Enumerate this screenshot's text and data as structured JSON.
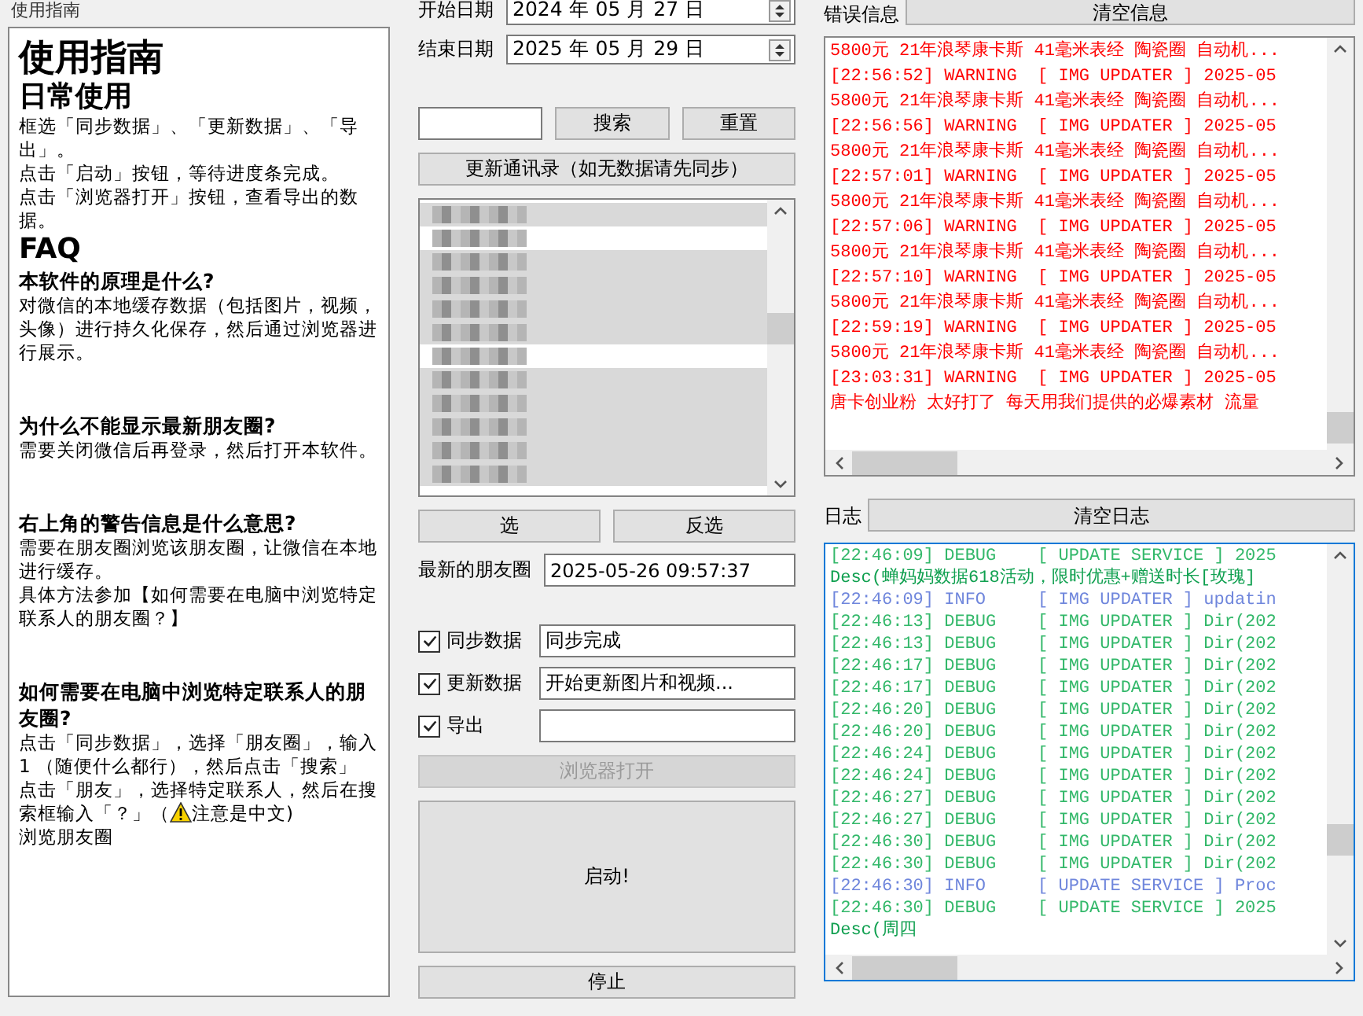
{
  "guide": {
    "legend": "使用指南",
    "blocks": [
      {
        "kind": "h1",
        "text": "使用指南"
      },
      {
        "kind": "h2",
        "text": "日常使用"
      },
      {
        "kind": "p",
        "text": "框选「同步数据」、「更新数据」、「导出」。"
      },
      {
        "kind": "p",
        "text": "点击「启动」按钮，等待进度条完成。"
      },
      {
        "kind": "p",
        "text": "点击「浏览器打开」按钮，查看导出的数据。"
      },
      {
        "kind": "h2",
        "text": "FAQ"
      },
      {
        "kind": "h3",
        "text": "本软件的原理是什么?"
      },
      {
        "kind": "p",
        "text": "对微信的本地缓存数据（包括图片，视频，头像）进行持久化保存，然后通过浏览器进行展示。"
      },
      {
        "kind": "gap"
      },
      {
        "kind": "h3",
        "text": "为什么不能显示最新朋友圈?"
      },
      {
        "kind": "p",
        "text": "需要关闭微信后再登录，然后打开本软件。"
      },
      {
        "kind": "gap"
      },
      {
        "kind": "h3",
        "text": "右上角的警告信息是什么意思?"
      },
      {
        "kind": "p",
        "text": "需要在朋友圈浏览该朋友圈，让微信在本地进行缓存。"
      },
      {
        "kind": "p",
        "text": "具体方法参加【如何需要在电脑中浏览特定联系人的朋友圈？】"
      },
      {
        "kind": "gap"
      },
      {
        "kind": "h3",
        "text": "如何需要在电脑中浏览特定联系人的朋友圈?"
      },
      {
        "kind": "p",
        "text": "点击「同步数据」，选择「朋友圈」，输入1 （随便什么都行），然后点击「搜索」"
      },
      {
        "kind": "p",
        "text": "点击「朋友」，选择特定联系人，然后在搜"
      },
      {
        "kind": "warn",
        "text": "索框输入「？」（",
        "after": "注意是中文)"
      },
      {
        "kind": "p",
        "text": "浏览朋友圈"
      }
    ]
  },
  "start_date": {
    "label": "开始日期",
    "value": "2024 年 05 月 27 日"
  },
  "end_date": {
    "label": "结束日期",
    "value": "2025 年 05 月 29 日"
  },
  "search": {
    "button": "搜索",
    "reset": "重置"
  },
  "update_contacts": "更新通讯录（如无数据请先同步）",
  "contacts": [
    {
      "selected": true
    },
    {
      "selected": false
    },
    {
      "selected": true
    },
    {
      "selected": true
    },
    {
      "selected": true
    },
    {
      "selected": true
    },
    {
      "selected": false
    },
    {
      "selected": true
    },
    {
      "selected": true
    },
    {
      "selected": true
    },
    {
      "selected": true
    },
    {
      "selected": true
    }
  ],
  "select_all": "选",
  "invert": "反选",
  "latest": {
    "label": "最新的朋友圈",
    "value": "2025-05-26 09:57:37"
  },
  "tasks": [
    {
      "label": "同步数据",
      "checked": true,
      "status": "同步完成"
    },
    {
      "label": "更新数据",
      "checked": true,
      "status": "开始更新图片和视频..."
    },
    {
      "label": "导出",
      "checked": true
    }
  ],
  "browser_open": {
    "label": "浏览器打开",
    "disabled": true
  },
  "start": "启动!",
  "stop": "停止",
  "errors": {
    "label": "错误信息",
    "clear": "清空信息",
    "lines": [
      "5800元 21年浪琴康卡斯 41毫米表经 陶瓷圈 自动机...",
      "[22:56:52] WARNING  [ IMG UPDATER ] 2025-05",
      "5800元 21年浪琴康卡斯 41毫米表经 陶瓷圈 自动机...",
      "[22:56:56] WARNING  [ IMG UPDATER ] 2025-05",
      "5800元 21年浪琴康卡斯 41毫米表经 陶瓷圈 自动机...",
      "[22:57:01] WARNING  [ IMG UPDATER ] 2025-05",
      "5800元 21年浪琴康卡斯 41毫米表经 陶瓷圈 自动机...",
      "[22:57:06] WARNING  [ IMG UPDATER ] 2025-05",
      "5800元 21年浪琴康卡斯 41毫米表经 陶瓷圈 自动机...",
      "[22:57:10] WARNING  [ IMG UPDATER ] 2025-05",
      "5800元 21年浪琴康卡斯 41毫米表经 陶瓷圈 自动机...",
      "[22:59:19] WARNING  [ IMG UPDATER ] 2025-05",
      "5800元 21年浪琴康卡斯 41毫米表经 陶瓷圈 自动机...",
      "[23:03:31] WARNING  [ IMG UPDATER ] 2025-05",
      "唐卡创业粉 太好打了 每天用我们提供的必爆素材 流量"
    ]
  },
  "log": {
    "label": "日志",
    "clear": "清空日志",
    "lines": [
      {
        "kind": "debug",
        "text": "[22:46:09] DEBUG    [ UPDATE SERVICE ] 2025"
      },
      {
        "kind": "desc",
        "text": "Desc(蝉妈妈数据618活动，限时优惠+赠送时长[玫瑰]"
      },
      {
        "kind": "info",
        "text": "[22:46:09] INFO     [ IMG UPDATER ] updatin"
      },
      {
        "kind": "debug",
        "text": "[22:46:13] DEBUG    [ IMG UPDATER ] Dir(202"
      },
      {
        "kind": "debug",
        "text": "[22:46:13] DEBUG    [ IMG UPDATER ] Dir(202"
      },
      {
        "kind": "debug",
        "text": "[22:46:17] DEBUG    [ IMG UPDATER ] Dir(202"
      },
      {
        "kind": "debug",
        "text": "[22:46:17] DEBUG    [ IMG UPDATER ] Dir(202"
      },
      {
        "kind": "debug",
        "text": "[22:46:20] DEBUG    [ IMG UPDATER ] Dir(202"
      },
      {
        "kind": "debug",
        "text": "[22:46:20] DEBUG    [ IMG UPDATER ] Dir(202"
      },
      {
        "kind": "debug",
        "text": "[22:46:24] DEBUG    [ IMG UPDATER ] Dir(202"
      },
      {
        "kind": "debug",
        "text": "[22:46:24] DEBUG    [ IMG UPDATER ] Dir(202"
      },
      {
        "kind": "debug",
        "text": "[22:46:27] DEBUG    [ IMG UPDATER ] Dir(202"
      },
      {
        "kind": "debug",
        "text": "[22:46:27] DEBUG    [ IMG UPDATER ] Dir(202"
      },
      {
        "kind": "debug",
        "text": "[22:46:30] DEBUG    [ IMG UPDATER ] Dir(202"
      },
      {
        "kind": "debug",
        "text": "[22:46:30] DEBUG    [ IMG UPDATER ] Dir(202"
      },
      {
        "kind": "info",
        "text": "[22:46:30] INFO     [ UPDATE SERVICE ] Proc"
      },
      {
        "kind": "debug",
        "text": "[22:46:30] DEBUG    [ UPDATE SERVICE ] 2025"
      },
      {
        "kind": "desc",
        "text": "Desc(周四"
      }
    ]
  }
}
